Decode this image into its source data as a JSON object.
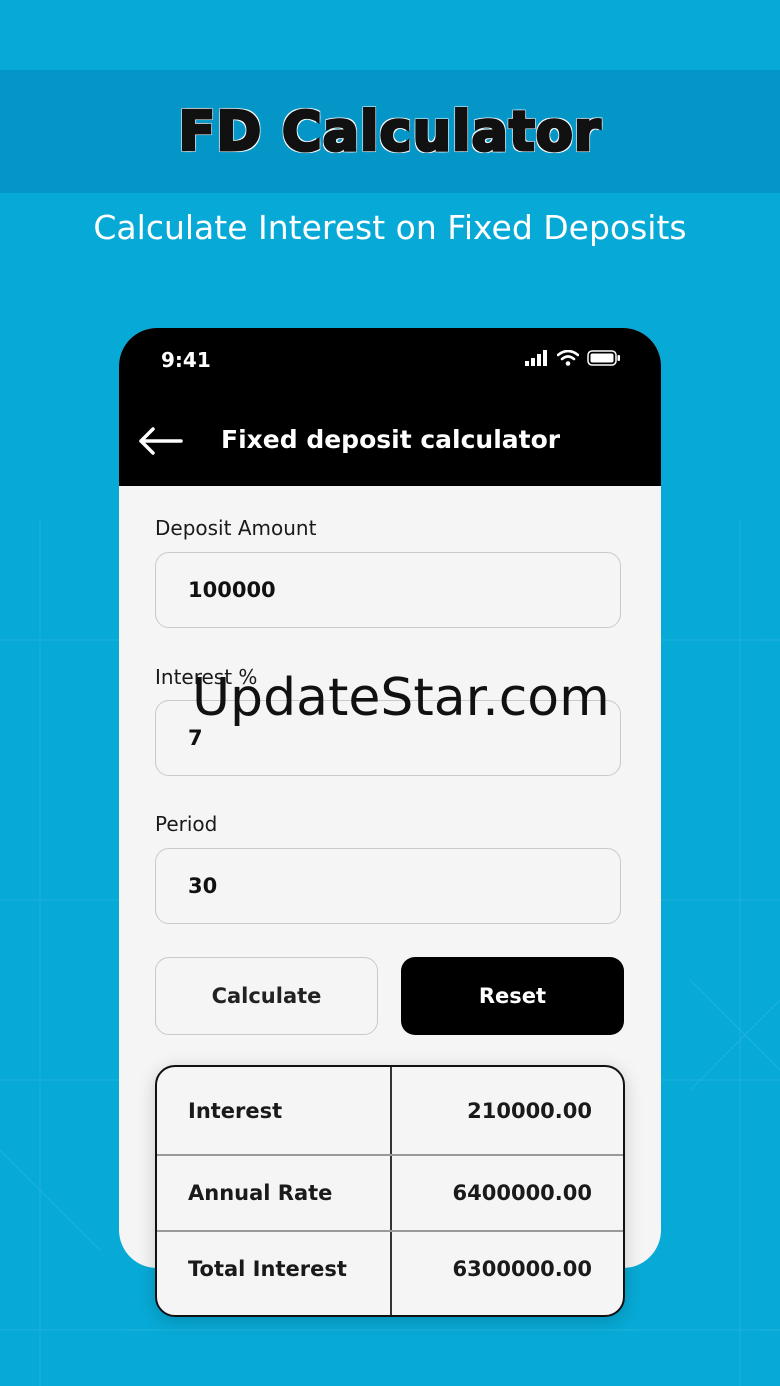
{
  "banner": {
    "title": "FD Calculator",
    "subtitle": "Calculate Interest on Fixed Deposits"
  },
  "status_bar": {
    "time": "9:41",
    "icons": [
      "signal-icon",
      "wifi-icon",
      "battery-icon"
    ]
  },
  "app_bar": {
    "title": "Fixed deposit calculator",
    "back_icon": "back-arrow-icon"
  },
  "form": {
    "deposit_label": "Deposit Amount",
    "deposit_value": "100000",
    "interest_label": "Interest %",
    "interest_value": "7",
    "period_label": "Period",
    "period_value": "30"
  },
  "buttons": {
    "calculate": "Calculate",
    "reset": "Reset"
  },
  "results": [
    {
      "label": "Interest",
      "value": "210000.00"
    },
    {
      "label": "Annual Rate",
      "value": "6400000.00"
    },
    {
      "label": "Total Interest",
      "value": "6300000.00"
    }
  ],
  "watermark": "UpdateStar.com",
  "colors": {
    "background": "#07aad6",
    "banner": "#0596c8",
    "phone_header": "#000000",
    "phone_body": "#f5f5f5"
  }
}
